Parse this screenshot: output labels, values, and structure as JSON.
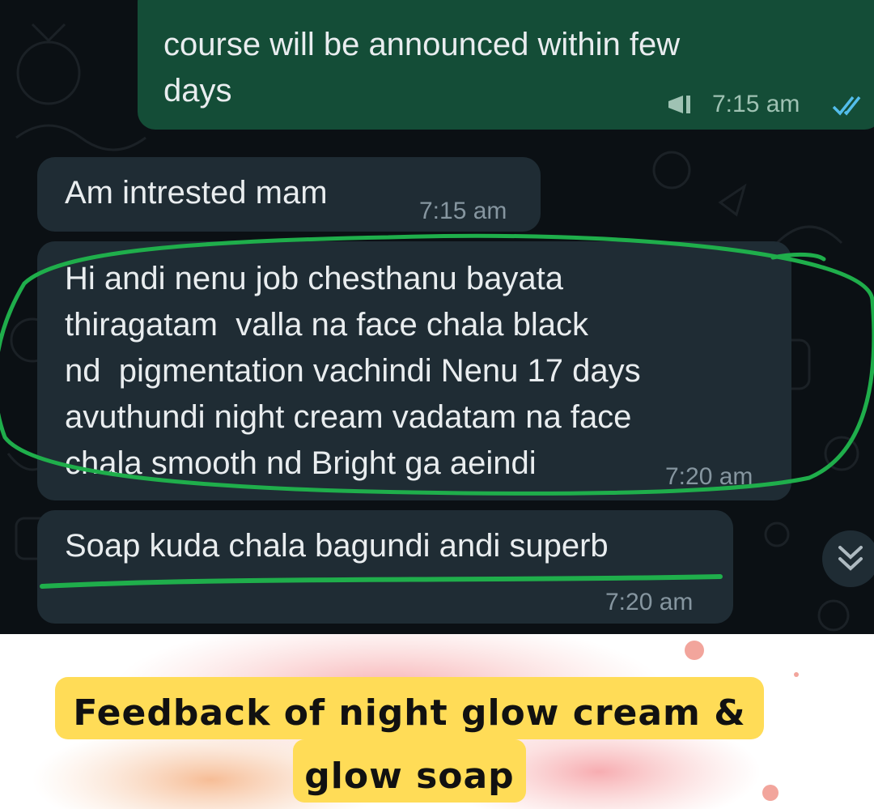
{
  "messages": [
    {
      "direction": "outgoing",
      "text": "course will be announced within few\ndays",
      "time": "7:15 am",
      "status_icon": "double-check-icon"
    },
    {
      "direction": "incoming",
      "text": "Am intrested mam",
      "time": "7:15 am"
    },
    {
      "direction": "incoming",
      "text": "Hi andi nenu job chesthanu bayata\nthiragatam  valla na face chala black\nnd  pigmentation vachindi Nenu 17 days\navuthundi night cream vadatam na face\nchala smooth nd Bright ga aeindi",
      "time": "7:20 am"
    },
    {
      "direction": "incoming",
      "text": "Soap kuda chala bagundi andi superb",
      "time": "7:20 am"
    }
  ],
  "scroll_down_icon": "double-chevron-down-icon",
  "caption": {
    "text": "Feedback of night glow cream &\nglow soap"
  },
  "colors": {
    "chat_bg": "#0b1014",
    "outgoing_bubble": "#144d37",
    "incoming_bubble": "#1f2c34",
    "annotation_green": "#1fae4b",
    "caption_highlight": "#ffdc57",
    "read_tick": "#53bdeb"
  }
}
